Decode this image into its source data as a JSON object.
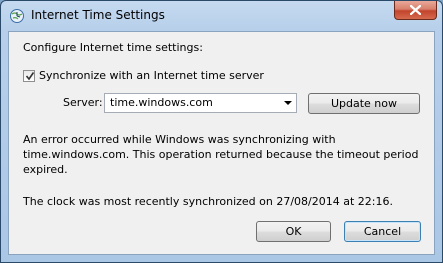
{
  "window": {
    "title": "Internet Time Settings"
  },
  "dialog": {
    "heading": "Configure Internet time settings:",
    "sync_checkbox": {
      "label": "Synchronize with an Internet time server",
      "checked": true
    },
    "server": {
      "label": "Server:",
      "value": "time.windows.com"
    },
    "update_button": "Update now",
    "error_line1": "An error occurred while Windows was synchronizing with",
    "error_line2": "time.windows.com.  This operation returned because the timeout period",
    "error_line3": "expired.",
    "last_sync": "The clock was most recently synchronized on 27/08/2014 at 22:16.",
    "ok_button": "OK",
    "cancel_button": "Cancel"
  },
  "icons": [
    "clock-globe-icon",
    "close-icon",
    "checkmark-icon",
    "dropdown-arrow-icon"
  ]
}
